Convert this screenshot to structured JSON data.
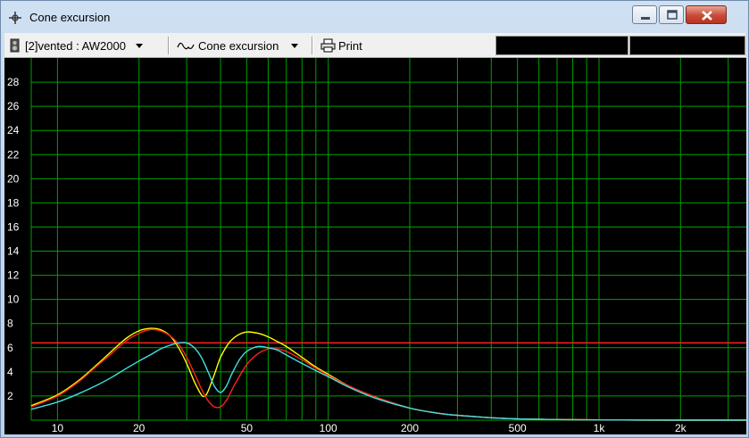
{
  "window": {
    "title": "Cone excursion",
    "title_icon": "crosshair-icon",
    "buttons": [
      "minimize-icon",
      "maximize-icon",
      "close-icon"
    ]
  },
  "toolbar": {
    "box_label": "[2]vented : AW2000",
    "box_icon": "speaker-box-icon",
    "graph_label": "Cone excursion",
    "graph_icon": "waveform-icon",
    "print_label": "Print",
    "print_icon": "printer-icon"
  },
  "colors": {
    "background": "#000000",
    "grid": "#00a000",
    "limit_line": "#ff2020",
    "yellow_curve": "#ffff00",
    "red_curve": "#ff2020",
    "cyan_curve": "#40e0e0"
  },
  "chart_data": {
    "type": "line",
    "title": "",
    "xlabel": "",
    "ylabel": "",
    "x_scale": "log",
    "xlim": [
      8,
      3500
    ],
    "ylim": [
      0,
      30
    ],
    "grid": true,
    "y_ticks": [
      2,
      4,
      6,
      8,
      10,
      12,
      14,
      16,
      18,
      20,
      22,
      24,
      26,
      28
    ],
    "x_ticks": [
      {
        "value": 10,
        "label": "10"
      },
      {
        "value": 20,
        "label": "20"
      },
      {
        "value": 50,
        "label": "50"
      },
      {
        "value": 100,
        "label": "100"
      },
      {
        "value": 200,
        "label": "200"
      },
      {
        "value": 500,
        "label": "500"
      },
      {
        "value": 1000,
        "label": "1k"
      },
      {
        "value": 2000,
        "label": "2k"
      }
    ],
    "limit": 6.4,
    "series": [
      {
        "color": "#ffff00",
        "x": [
          8,
          10,
          12,
          14,
          16,
          18,
          20,
          22,
          24,
          26,
          28,
          30,
          32,
          34,
          35,
          36,
          38,
          40,
          43,
          46,
          50,
          55,
          60,
          65,
          70,
          80,
          90,
          100,
          120,
          150,
          200,
          250,
          300,
          400,
          500,
          700,
          1000,
          2000,
          3500
        ],
        "y": [
          1.2,
          2.1,
          3.3,
          4.6,
          5.8,
          6.8,
          7.4,
          7.6,
          7.5,
          7.0,
          6.0,
          4.7,
          3.2,
          2.1,
          2.0,
          2.4,
          3.8,
          5.2,
          6.4,
          7.0,
          7.3,
          7.2,
          6.9,
          6.5,
          6.1,
          5.2,
          4.4,
          3.8,
          2.8,
          1.9,
          1.0,
          0.6,
          0.4,
          0.2,
          0.1,
          0.05,
          0.02,
          0.0,
          0.0
        ]
      },
      {
        "color": "#ff2020",
        "x": [
          8,
          10,
          12,
          14,
          16,
          18,
          20,
          22,
          24,
          26,
          28,
          30,
          32,
          34,
          36,
          38,
          40,
          42,
          45,
          50,
          55,
          60,
          65,
          70,
          80,
          90,
          100,
          120,
          150,
          200,
          250,
          300,
          400,
          500,
          700,
          1000,
          2000,
          3500
        ],
        "y": [
          1.1,
          2.0,
          3.2,
          4.5,
          5.6,
          6.6,
          7.2,
          7.5,
          7.4,
          7.0,
          6.3,
          5.2,
          3.9,
          2.6,
          1.6,
          1.1,
          1.1,
          1.6,
          2.9,
          4.6,
          5.5,
          5.9,
          5.9,
          5.7,
          5.0,
          4.3,
          3.7,
          2.8,
          1.9,
          1.0,
          0.6,
          0.4,
          0.2,
          0.1,
          0.05,
          0.02,
          0.0,
          0.0
        ]
      },
      {
        "color": "#40e0e0",
        "x": [
          8,
          10,
          12,
          14,
          16,
          18,
          20,
          22,
          24,
          26,
          28,
          30,
          32,
          34,
          36,
          38,
          40,
          42,
          44,
          47,
          50,
          55,
          60,
          65,
          70,
          80,
          90,
          100,
          120,
          150,
          200,
          250,
          300,
          400,
          500,
          700,
          1000,
          2000,
          3500
        ],
        "y": [
          0.9,
          1.5,
          2.2,
          2.9,
          3.6,
          4.3,
          4.9,
          5.4,
          5.9,
          6.2,
          6.4,
          6.4,
          6.0,
          5.2,
          4.0,
          2.8,
          2.3,
          2.8,
          3.8,
          5.0,
          5.7,
          6.1,
          6.0,
          5.8,
          5.4,
          4.7,
          4.1,
          3.6,
          2.7,
          1.8,
          1.0,
          0.6,
          0.4,
          0.2,
          0.1,
          0.05,
          0.02,
          0.0,
          0.0
        ]
      }
    ]
  }
}
